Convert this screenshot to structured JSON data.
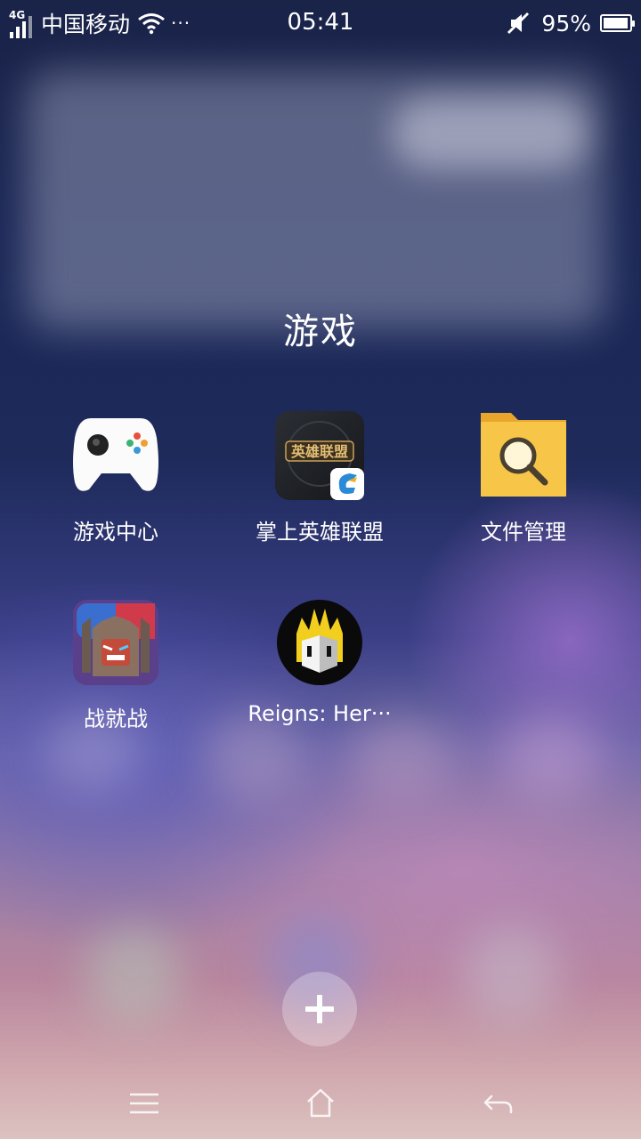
{
  "status_bar": {
    "network_type": "4G",
    "carrier": "中国移动",
    "more": "···",
    "time": "05:41",
    "battery_percent": "95%",
    "battery_level": 0.95,
    "signal_icon": "signal-bars-icon",
    "wifi_icon": "wifi-icon",
    "mute_icon": "mute-icon"
  },
  "folder": {
    "title": "游戏",
    "apps": [
      {
        "label": "游戏中心",
        "icon": "gamepad-icon"
      },
      {
        "label": "掌上英雄联盟",
        "icon": "league-of-legends-icon",
        "icon_text": "英雄联盟"
      },
      {
        "label": "文件管理",
        "icon": "file-manager-icon"
      },
      {
        "label": "战就战",
        "icon": "castle-warrior-icon"
      },
      {
        "label": "Reigns: Her···",
        "icon": "crowned-face-icon"
      }
    ]
  },
  "add_button": {
    "icon": "plus-icon"
  },
  "nav_bar": {
    "menu_icon": "menu-icon",
    "home_icon": "home-icon",
    "back_icon": "back-icon"
  }
}
